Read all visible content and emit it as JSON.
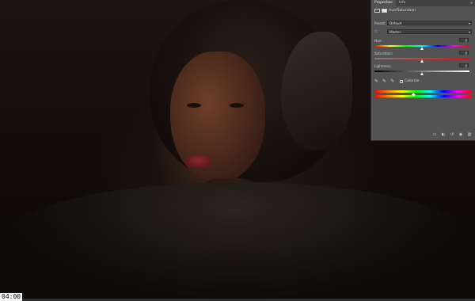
{
  "photo": {
    "subject": "portrait"
  },
  "properties_panel": {
    "tabs": [
      {
        "label": "Properties"
      },
      {
        "label": "Info"
      }
    ],
    "menu_icon": "double-chevron-icon",
    "adjustment_title": "Hue/Saturation",
    "preset_label": "Preset:",
    "preset_value": "Default",
    "channel_value": "Master",
    "hue_label": "Hue:",
    "hue_value": "0",
    "hue_level": 0,
    "saturation_label": "Saturation:",
    "saturation_value": "0",
    "saturation_level": 0,
    "lightness_label": "Lightness:",
    "lightness_value": "0",
    "lightness_level": 0,
    "colorize_label": "Colorize",
    "colorize_checked": false,
    "bottom_icons": [
      "clip-to-layer-icon",
      "view-previous-icon",
      "reset-icon",
      "visibility-icon",
      "delete-icon"
    ]
  },
  "video": {
    "timecode": "04:00"
  },
  "colors": {
    "panel_bg": "#535353",
    "spectrum": [
      "#ff0000",
      "#ffff00",
      "#00ff00",
      "#00ffff",
      "#0000ff",
      "#ff00ff",
      "#ff0000"
    ]
  }
}
